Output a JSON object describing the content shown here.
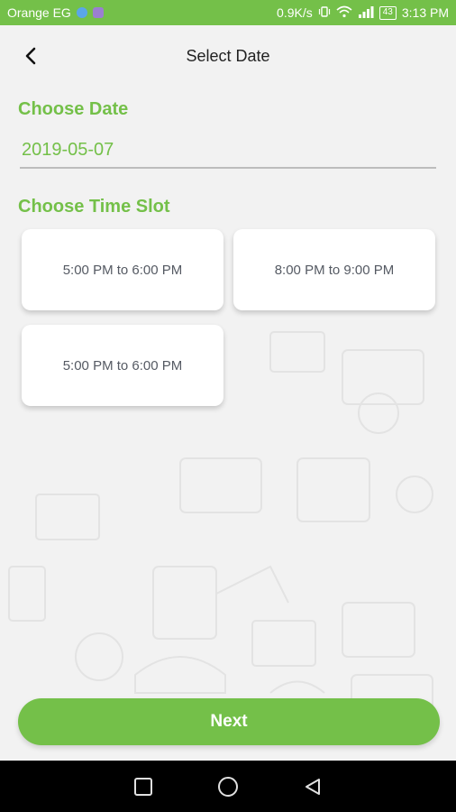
{
  "status_bar": {
    "carrier": "Orange EG",
    "speed": "0.9K/s",
    "battery": "43",
    "time": "3:13 PM",
    "icons": [
      "vibrate-icon",
      "wifi-icon",
      "signal-icon",
      "battery-icon"
    ]
  },
  "header": {
    "title": "Select Date",
    "back_icon": "back-arrow-icon"
  },
  "date_section": {
    "label": "Choose Date",
    "value": "2019-05-07"
  },
  "time_section": {
    "label": "Choose Time Slot",
    "slots": [
      {
        "label": "5:00 PM to 6:00 PM"
      },
      {
        "label": "8:00 PM to 9:00 PM"
      },
      {
        "label": "5:00 PM to 6:00 PM"
      }
    ]
  },
  "next_button": {
    "label": "Next"
  },
  "nav": {
    "icons": [
      "recents-square-icon",
      "home-circle-icon",
      "back-triangle-icon"
    ]
  },
  "colors": {
    "accent": "#74c049",
    "background": "#f2f2f2",
    "slot_text": "#555a63"
  }
}
